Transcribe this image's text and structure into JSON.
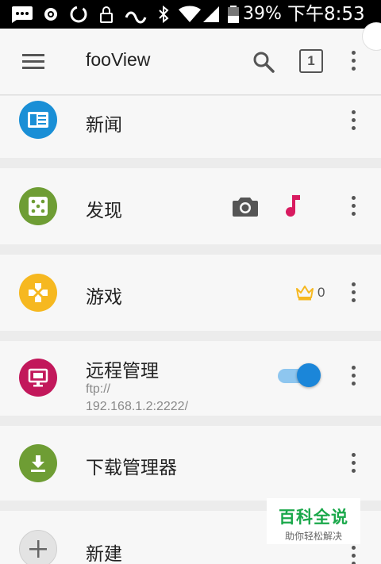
{
  "status_bar": {
    "battery": "39%",
    "time": "下午8:53"
  },
  "app_bar": {
    "title": "fooView",
    "tab_count": "1",
    "icons": [
      "menu-icon",
      "search-icon",
      "tabs-icon",
      "more-vert-icon"
    ]
  },
  "items": [
    {
      "label": "新闻",
      "icon": "news-icon",
      "color": "#1a8fd6"
    },
    {
      "label": "发现",
      "icon": "dice-icon",
      "color": "#6e9d34",
      "extras": [
        "camera-icon",
        "music-note-icon"
      ]
    },
    {
      "label": "游戏",
      "icon": "gamepad-icon",
      "color": "#f6b820",
      "crown_count": "0"
    },
    {
      "label": "远程管理",
      "icon": "remote-desktop-icon",
      "color": "#c2185b",
      "sub": "ftp://\n192.168.1.2:2222/",
      "toggle_on": true
    },
    {
      "label": "下载管理器",
      "icon": "download-icon",
      "color": "#6e9d34"
    },
    {
      "label": "新建",
      "icon": "add-icon",
      "color": "#e3e3e3"
    }
  ],
  "watermark": {
    "title": "百科全说",
    "subtitle": "助你轻松解决"
  },
  "colors": {
    "accent": "#1b86d9",
    "music": "#d81b60",
    "crown": "#f6b820"
  }
}
